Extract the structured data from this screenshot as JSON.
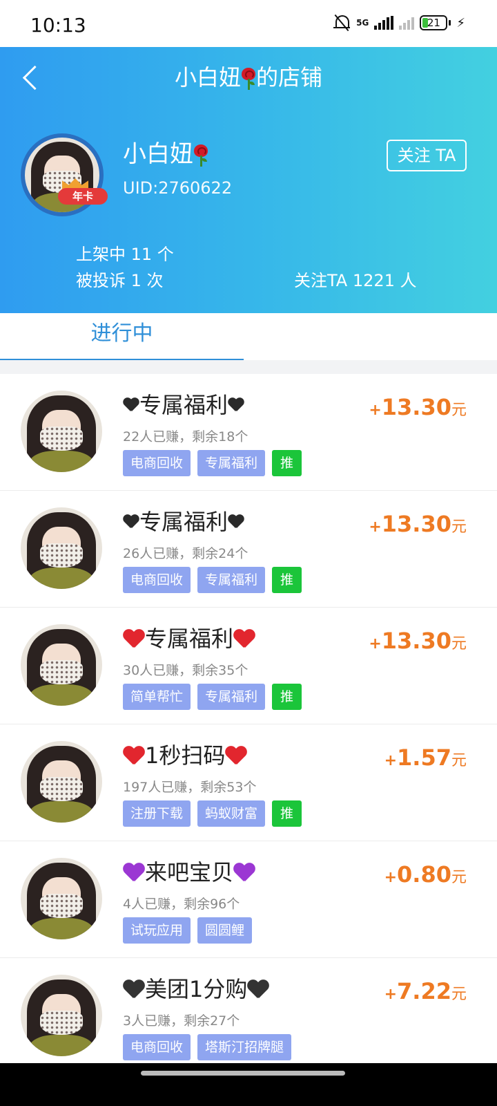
{
  "status_bar": {
    "time": "10:13",
    "network": "5G",
    "battery": "21",
    "icons": [
      "bell-off-icon",
      "signal-icon",
      "signal-icon",
      "battery-icon",
      "charging-icon"
    ]
  },
  "header": {
    "title_prefix": "小白妞",
    "title_suffix": "的店铺",
    "title_emoji": "rose-icon",
    "shop_name": "小白妞",
    "uid": "UID:2760622",
    "badge": "年卡",
    "follow_button": "关注 TA",
    "stats": {
      "on_shelf": "上架中 11 个",
      "complaints": "被投诉 1 次",
      "followers": "关注TA 1221 人"
    },
    "colors": {
      "gradient_start": "#2f9cf0",
      "gradient_end": "#43d0e0"
    }
  },
  "tabs": [
    {
      "label": "进行中",
      "active": true
    }
  ],
  "tasks": [
    {
      "heart": "black-heart",
      "title": "专属福利",
      "stats": "22人已赚，剩余18个",
      "tags": [
        "电商回收",
        "专属福利"
      ],
      "push": "推",
      "price_sign": "+",
      "price": "13.30",
      "unit": "元"
    },
    {
      "heart": "black-heart",
      "title": "专属福利",
      "stats": "26人已赚，剩余24个",
      "tags": [
        "电商回收",
        "专属福利"
      ],
      "push": "推",
      "price_sign": "+",
      "price": "13.30",
      "unit": "元"
    },
    {
      "heart": "red-heart",
      "title": "专属福利",
      "stats": "30人已赚，剩余35个",
      "tags": [
        "简单帮忙",
        "专属福利"
      ],
      "push": "推",
      "price_sign": "+",
      "price": "13.30",
      "unit": "元"
    },
    {
      "heart": "red-heart",
      "title": "1秒扫码",
      "stats": "197人已赚，剩余53个",
      "tags": [
        "注册下载",
        "蚂蚁财富"
      ],
      "push": "推",
      "price_sign": "+",
      "price": "1.57",
      "unit": "元"
    },
    {
      "heart": "purple-heart",
      "title": "来吧宝贝",
      "stats": "4人已赚，剩余96个",
      "tags": [
        "试玩应用",
        "圆圆鲤"
      ],
      "push": null,
      "price_sign": "+",
      "price": "0.80",
      "unit": "元"
    },
    {
      "heart": "black-heart-emoji",
      "title": "美团1分购",
      "stats": "3人已赚，剩余27个",
      "tags": [
        "电商回收",
        "塔斯汀招牌腿"
      ],
      "push": null,
      "price_sign": "+",
      "price": "7.22",
      "unit": "元"
    }
  ],
  "colors": {
    "price": "#ee7a23",
    "tag": "#8fa5f0",
    "push_tag": "#1bc53a",
    "tab_active": "#2f8fd8"
  }
}
